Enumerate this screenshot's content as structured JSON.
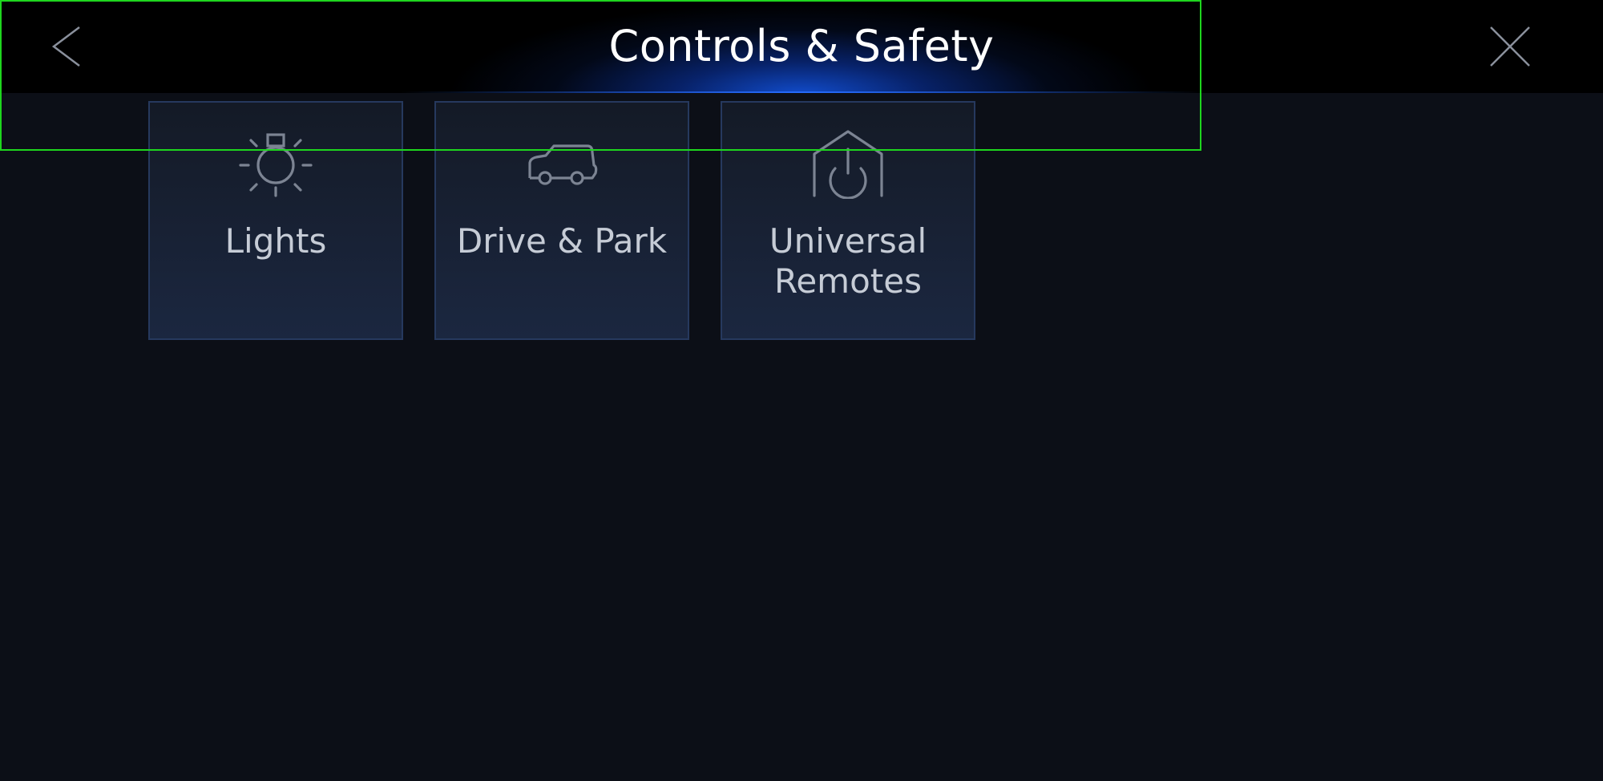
{
  "header": {
    "title": "Controls & Safety",
    "back_icon": "chevron-left-icon",
    "close_icon": "close-icon"
  },
  "tiles": [
    {
      "label": "Lights",
      "icon": "exterior-light-icon"
    },
    {
      "label": "Drive & Park",
      "icon": "car-icon"
    },
    {
      "label": "Universal\nRemotes",
      "icon": "garage-power-icon"
    }
  ],
  "colors": {
    "background": "#0c0f17",
    "header_glow": "#1250d7",
    "tile_border": "#26395e",
    "label_text": "#c6ccd6",
    "icon_stroke": "#7c8493",
    "highlight": "#1ed61e"
  }
}
